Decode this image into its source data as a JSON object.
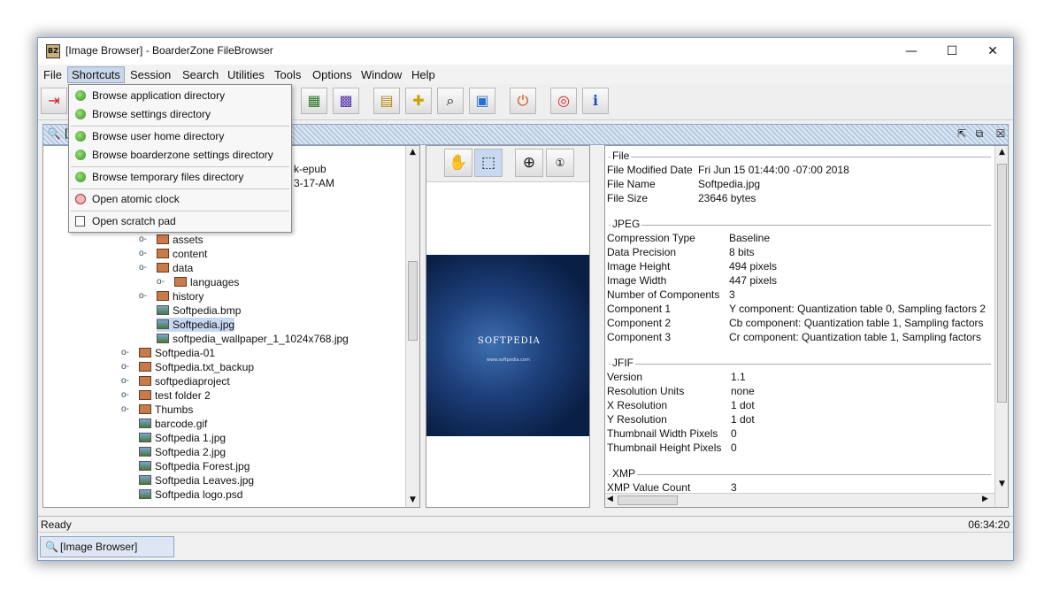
{
  "window": {
    "title": "[Image Browser] - BoarderZone FileBrowser",
    "app_icon_text": "BZ",
    "minimize": "—",
    "maximize": "☐",
    "close": "✕"
  },
  "menubar": [
    "File",
    "Shortcuts",
    "Session",
    "Search",
    "Utilities",
    "Tools",
    "Options",
    "Window",
    "Help"
  ],
  "shortcuts_menu": {
    "items": [
      {
        "label": "Browse application directory",
        "icon": "tree-icon"
      },
      {
        "label": "Browse settings directory",
        "icon": "tree-icon"
      },
      {
        "label": "Browse user home directory",
        "icon": "tree-icon"
      },
      {
        "label": "Browse boarderzone settings directory",
        "icon": "tree-icon"
      },
      {
        "label": "Browse temporary files directory",
        "icon": "tree-icon"
      },
      {
        "label": "Open atomic clock",
        "icon": "clock-icon"
      },
      {
        "label": "Open scratch pad",
        "icon": "scratchpad-icon"
      }
    ]
  },
  "toolbar": {
    "icons": [
      "exit-icon",
      "chart-icon",
      "palette-icon",
      "clipboard-icon",
      "ruler-icon",
      "magnifier-icon",
      "screen-icon",
      "power-icon",
      "lifebuoy-icon",
      "info-icon"
    ]
  },
  "inner_window": {
    "title_partial": "[",
    "title_icon": "image-browser-icon"
  },
  "tree": {
    "partial_rows": [
      "k-epub",
      "3-17-AM"
    ],
    "rows": [
      {
        "label": "assets",
        "type": "folder",
        "indent": 3,
        "expander": "o-"
      },
      {
        "label": "content",
        "type": "folder",
        "indent": 3,
        "expander": "o-"
      },
      {
        "label": "data",
        "type": "folder-open",
        "indent": 3,
        "expander": "o-"
      },
      {
        "label": "languages",
        "type": "folder",
        "indent": 4,
        "expander": "o-"
      },
      {
        "label": "history",
        "type": "folder",
        "indent": 3,
        "expander": "o-"
      },
      {
        "label": "Softpedia.bmp",
        "type": "image",
        "indent": 3,
        "expander": ""
      },
      {
        "label": "Softpedia.jpg",
        "type": "image",
        "indent": 3,
        "expander": "",
        "selected": true
      },
      {
        "label": "softpedia_wallpaper_1_1024x768.jpg",
        "type": "image",
        "indent": 3,
        "expander": ""
      },
      {
        "label": "Softpedia-01",
        "type": "folder",
        "indent": 2,
        "expander": "o-"
      },
      {
        "label": "Softpedia.txt_backup",
        "type": "folder",
        "indent": 2,
        "expander": "o-"
      },
      {
        "label": "softpediaproject",
        "type": "folder",
        "indent": 2,
        "expander": "o-"
      },
      {
        "label": "test folder 2",
        "type": "folder",
        "indent": 2,
        "expander": "o-"
      },
      {
        "label": "Thumbs",
        "type": "folder",
        "indent": 2,
        "expander": "o-"
      },
      {
        "label": "barcode.gif",
        "type": "image",
        "indent": 2,
        "expander": ""
      },
      {
        "label": "Softpedia 1.jpg",
        "type": "image",
        "indent": 2,
        "expander": ""
      },
      {
        "label": "Softpedia 2.jpg",
        "type": "image",
        "indent": 2,
        "expander": ""
      },
      {
        "label": "Softpedia Forest.jpg",
        "type": "image",
        "indent": 2,
        "expander": ""
      },
      {
        "label": "Softpedia Leaves.jpg",
        "type": "image",
        "indent": 2,
        "expander": ""
      },
      {
        "label": "Softpedia logo.psd",
        "type": "image",
        "indent": 2,
        "expander": ""
      }
    ]
  },
  "preview": {
    "tools": [
      "hand-icon",
      "select-rect-icon",
      "zoom-in-icon",
      "zoom-actual-icon"
    ],
    "image_title": "SOFTPEDIA",
    "image_url": "www.softpedia.com"
  },
  "info": {
    "sections": [
      {
        "name": "File",
        "rows": [
          [
            "File Modified Date",
            "Fri Jun 15 01:44:00 -07:00 2018"
          ],
          [
            "File Name",
            "Softpedia.jpg"
          ],
          [
            "File Size",
            "23646 bytes"
          ]
        ]
      },
      {
        "name": "JPEG",
        "rows": [
          [
            "Compression Type",
            "Baseline"
          ],
          [
            "Data Precision",
            "8 bits"
          ],
          [
            "Image Height",
            "494 pixels"
          ],
          [
            "Image Width",
            "447 pixels"
          ],
          [
            "Number of Components",
            "3"
          ],
          [
            "Component 1",
            "Y component: Quantization table 0, Sampling factors 2"
          ],
          [
            "Component 2",
            "Cb component: Quantization table 1, Sampling factors"
          ],
          [
            "Component 3",
            "Cr component: Quantization table 1, Sampling factors"
          ]
        ]
      },
      {
        "name": "JFIF",
        "rows": [
          [
            "Version",
            "1.1"
          ],
          [
            "Resolution Units",
            "none"
          ],
          [
            "X Resolution",
            "1 dot"
          ],
          [
            "Y Resolution",
            "1 dot"
          ],
          [
            "Thumbnail Width Pixels",
            "0"
          ],
          [
            "Thumbnail Height Pixels",
            "0"
          ]
        ]
      },
      {
        "name": "XMP",
        "rows": [
          [
            "XMP Value Count",
            "3"
          ]
        ]
      }
    ]
  },
  "status": {
    "text": "Ready",
    "time": "06:34:20"
  },
  "taskbar": {
    "tab_label": "[Image Browser]"
  }
}
